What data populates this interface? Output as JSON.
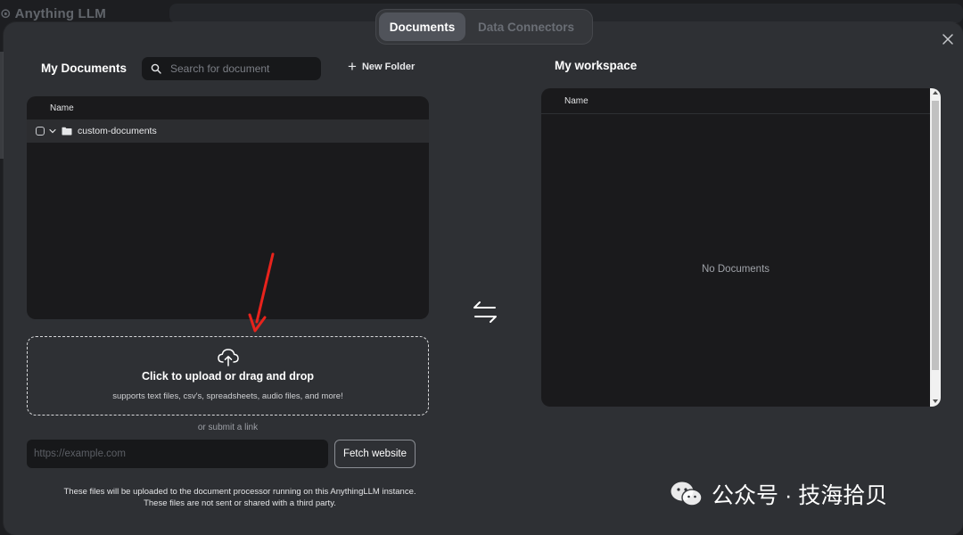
{
  "app": {
    "name": "Anything LLM"
  },
  "tabs": [
    {
      "label": "Documents",
      "active": true
    },
    {
      "label": "Data Connectors",
      "active": false
    }
  ],
  "my_documents": {
    "title": "My Documents",
    "search_placeholder": "Search for document",
    "new_folder_label": "New Folder",
    "column_header": "Name",
    "items": [
      {
        "name": "custom-documents",
        "type": "folder"
      }
    ]
  },
  "upload": {
    "title": "Click to upload or drag and drop",
    "subtitle": "supports text files, csv's, spreadsheets, audio files, and more!",
    "or_link": "or submit a link",
    "url_placeholder": "https://example.com",
    "fetch_label": "Fetch website",
    "disclaimer_line1": "These files will be uploaded to the document processor running on this AnythingLLM instance.",
    "disclaimer_line2": "These files are not sent or shared with a third party."
  },
  "workspace": {
    "title": "My workspace",
    "column_header": "Name",
    "empty_text": "No Documents"
  },
  "watermark": {
    "text": "公众号 · 技海拾贝"
  },
  "colors": {
    "annotation_arrow": "#e8231c",
    "modal_bg": "#2e3034",
    "panel_bg": "#1a1a1c"
  }
}
